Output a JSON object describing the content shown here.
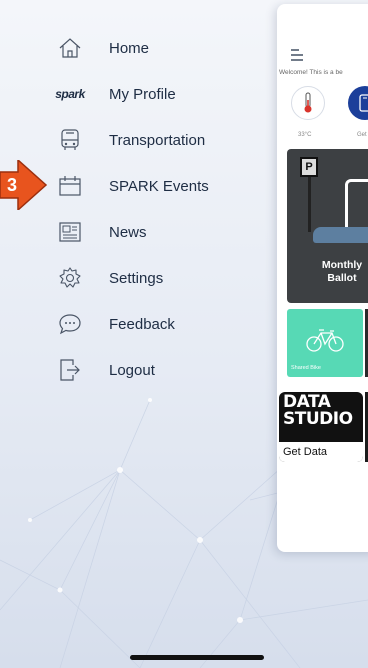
{
  "menu": {
    "items": [
      {
        "id": "home",
        "label": "Home",
        "icon": "home-icon"
      },
      {
        "id": "profile",
        "label": "My Profile",
        "icon": "spark-logo-icon",
        "logo_text": "spark"
      },
      {
        "id": "transportation",
        "label": "Transportation",
        "icon": "bus-icon"
      },
      {
        "id": "events",
        "label": "SPARK Events",
        "icon": "calendar-icon"
      },
      {
        "id": "news",
        "label": "News",
        "icon": "newspaper-icon"
      },
      {
        "id": "settings",
        "label": "Settings",
        "icon": "gear-icon"
      },
      {
        "id": "feedback",
        "label": "Feedback",
        "icon": "chat-bubble-icon"
      },
      {
        "id": "logout",
        "label": "Logout",
        "icon": "logout-icon"
      }
    ]
  },
  "annotation": {
    "digit": "3",
    "color": "#e8541e"
  },
  "app": {
    "welcome_text": "Welcome! This is a be",
    "temperature": "33°C",
    "get_label": "Get",
    "parking_text": "Monthly\nBallot",
    "bike_label": "Shared Bike",
    "data_studio_title": "DATA\nSTUDIO",
    "data_studio_button": "Get Data"
  },
  "colors": {
    "text": "#1e2d44",
    "accent_blue": "#1c3f9a",
    "bike_green": "#57d9b5"
  }
}
